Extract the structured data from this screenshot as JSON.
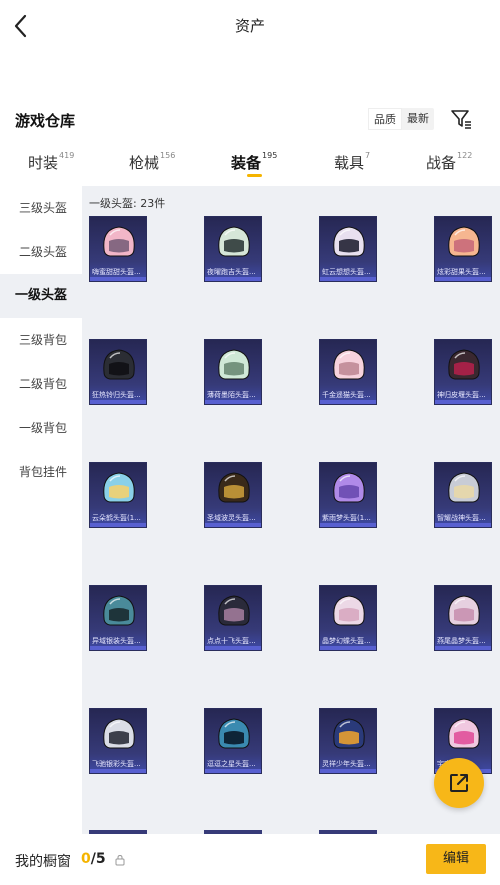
{
  "header": {
    "title": "资产"
  },
  "warehouse": {
    "title": "游戏仓库",
    "sort_quality": "品质",
    "sort_latest": "最新"
  },
  "tabs": [
    {
      "label": "时装",
      "count": "419"
    },
    {
      "label": "枪械",
      "count": "156"
    },
    {
      "label": "装备",
      "count": "195"
    },
    {
      "label": "载具",
      "count": "7"
    },
    {
      "label": "战备",
      "count": "122"
    }
  ],
  "sidebar": [
    {
      "label": "三级头盔"
    },
    {
      "label": "二级头盔"
    },
    {
      "label": "一级头盔"
    },
    {
      "label": "三级背包"
    },
    {
      "label": "二级背包"
    },
    {
      "label": "一级背包"
    },
    {
      "label": "背包挂件"
    }
  ],
  "grid": {
    "header": "一级头盔: 23件"
  },
  "items": [
    {
      "name": "嗨蜜甜甜头盔...",
      "shell": "#f2b6c8",
      "visor": "#7a5f7a"
    },
    {
      "name": "夜曜跑吉头盔...",
      "shell": "#d6e6d8",
      "visor": "#2f3a3a"
    },
    {
      "name": "虹云想想头盔...",
      "shell": "#e8e0ef",
      "visor": "#222233"
    },
    {
      "name": "炫彩甜果头盔...",
      "shell": "#f6b690",
      "visor": "#c96a7a"
    },
    {
      "name": "狂热铃归头盔...",
      "shell": "#2b2d34",
      "visor": "#101014"
    },
    {
      "name": "薄荷墨陌头盔...",
      "shell": "#cfe8d6",
      "visor": "#6a8a74"
    },
    {
      "name": "千金遥猫头盔...",
      "shell": "#f6d2dc",
      "visor": "#c08a96"
    },
    {
      "name": "神归皮堰头盔...",
      "shell": "#3a2830",
      "visor": "#b0204a"
    },
    {
      "name": "云朵鹤头盔(1...",
      "shell": "#8ad0e8",
      "visor": "#f2d070"
    },
    {
      "name": "圣域波灵头盔...",
      "shell": "#3a2a1a",
      "visor": "#c89a3a"
    },
    {
      "name": "紫雨梦头盔(1...",
      "shell": "#b08ae8",
      "visor": "#6a4ab0"
    },
    {
      "name": "智耀战神头盔...",
      "shell": "#c8ccd6",
      "visor": "#e8d8a8"
    },
    {
      "name": "异域银装头盔...",
      "shell": "#4a8a9a",
      "visor": "#1a2a30"
    },
    {
      "name": "点点十飞头盔...",
      "shell": "#2a2a3a",
      "visor": "#a07a9a"
    },
    {
      "name": "晶梦幻蝶头盔...",
      "shell": "#ecd8e6",
      "visor": "#d8a8c0"
    },
    {
      "name": "燕尾晶梦头盔...",
      "shell": "#e6d0e0",
      "visor": "#c890b0"
    },
    {
      "name": "飞驰银彩头盔...",
      "shell": "#dadde6",
      "visor": "#2a2d3a"
    },
    {
      "name": "逗逗之星头盔...",
      "shell": "#3a8ab0",
      "visor": "#0a1a2a"
    },
    {
      "name": "灵祥少年头盔...",
      "shell": "#2a3a7a",
      "visor": "#e8a030"
    },
    {
      "name": "宇宙...",
      "shell": "#f0c8e0",
      "visor": "#e0509a"
    }
  ],
  "bottom": {
    "showcase_label": "我的橱窗",
    "current": "0",
    "total": "/5",
    "edit_label": "编辑"
  },
  "colors": {
    "accent": "#f7b718",
    "grid_bg": "#eef0f4",
    "card_bg": "#2b2d60"
  },
  "icons": {
    "back": "chevron-left-icon",
    "filter": "filter-icon",
    "share": "share-external-icon",
    "lock": "lock-icon"
  }
}
